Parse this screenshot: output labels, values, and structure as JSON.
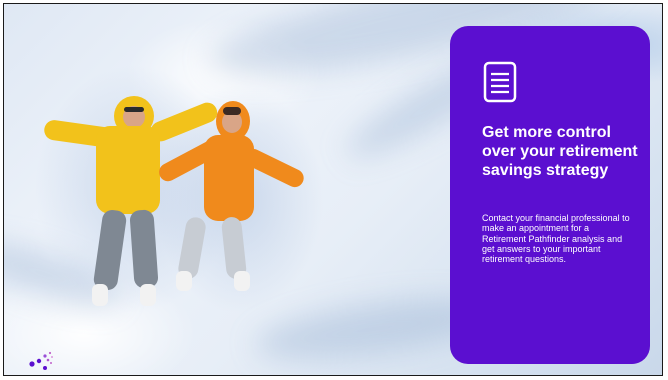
{
  "card": {
    "icon": "document-icon",
    "title": "Get more control over your retirement savings strategy",
    "body": "Contact your financial professional to make an appointment for a Retirement Pathfinder analysis and get answers to your important retirement questions.",
    "background_color": "#5b0fd0",
    "text_color": "#ffffff"
  },
  "photo": {
    "subject": "couple-making-snow-angels",
    "people_colors": [
      "#f2c21b",
      "#f08a1c"
    ]
  },
  "logo": {
    "icon": "dots-logo-icon",
    "colors": [
      "#5b0fd0",
      "#c061c9"
    ]
  }
}
